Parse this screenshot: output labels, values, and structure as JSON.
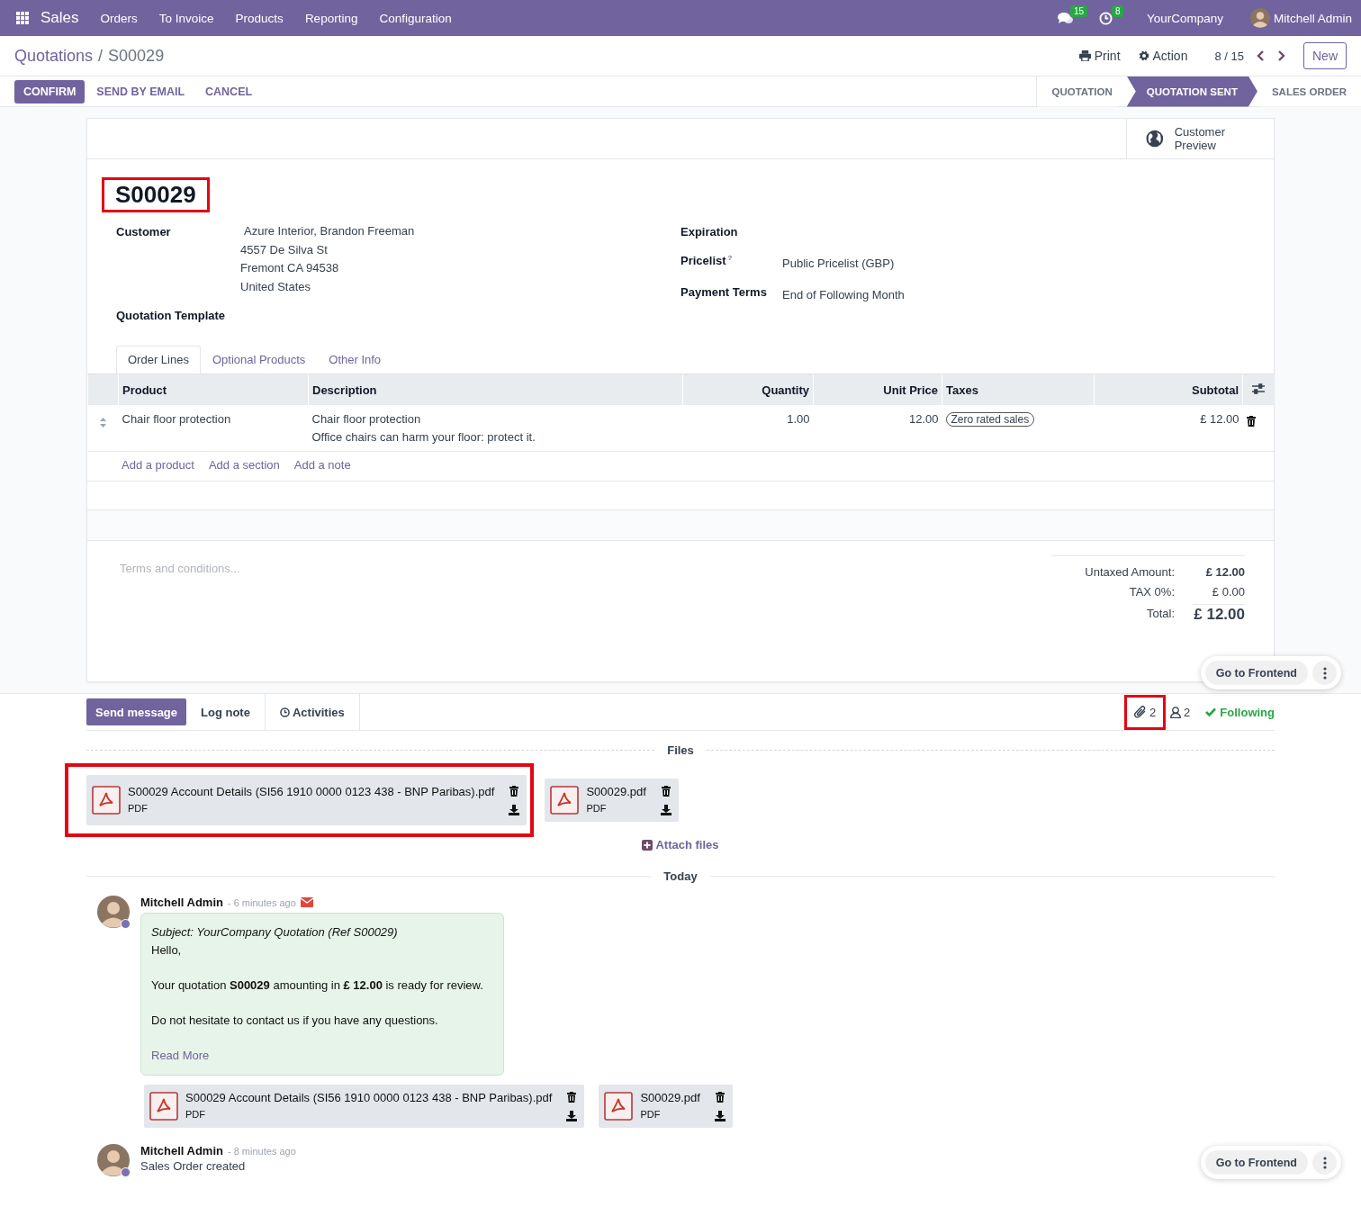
{
  "navbar": {
    "app": "Sales",
    "menus": [
      "Orders",
      "To Invoice",
      "Products",
      "Reporting",
      "Configuration"
    ],
    "messages_count": "15",
    "activities_count": "8",
    "company": "YourCompany",
    "user": "Mitchell Admin"
  },
  "breadcrumb": {
    "parent": "Quotations",
    "separator": "/",
    "current": "S00029"
  },
  "toolbar": {
    "print": "Print",
    "action": "Action",
    "pager": "8 / 15",
    "new": "New"
  },
  "buttons": [
    {
      "label": "CONFIRM",
      "primary": true
    },
    {
      "label": "SEND BY EMAIL",
      "primary": false
    },
    {
      "label": "CANCEL",
      "primary": false
    }
  ],
  "statusbar": [
    {
      "label": "QUOTATION",
      "selected": false
    },
    {
      "label": "QUOTATION SENT",
      "selected": true
    },
    {
      "label": "SALES ORDER",
      "selected": false
    }
  ],
  "form": {
    "smart_button": "Customer Preview",
    "title": {
      "text": "S00029",
      "highlighted": true
    },
    "left_fields": [
      {
        "label": "Customer",
        "lines": [
          "Azure Interior, Brandon Freeman",
          "4557 De Silva St",
          "Fremont CA 94538",
          "United States"
        ]
      },
      {
        "label": "Quotation Template"
      }
    ],
    "right_fields": [
      {
        "label": "Expiration"
      },
      {
        "label": "Pricelist",
        "help": "?",
        "value": "Public Pricelist (GBP)"
      },
      {
        "label": "Payment Terms",
        "value": "End of Following Month"
      }
    ],
    "tabs": [
      {
        "label": "Order Lines",
        "selected": true
      },
      {
        "label": "Optional Products",
        "selected": false
      },
      {
        "label": "Other Info",
        "selected": false
      }
    ],
    "columns": [
      "Product",
      "Description",
      "Quantity",
      "Unit Price",
      "Taxes",
      "Subtotal"
    ],
    "rows": [
      {
        "product": "Chair floor protection",
        "description": [
          "Chair floor protection",
          "Office chairs can harm your floor: protect it."
        ],
        "quantity": "1.00",
        "unit_price": "12.00",
        "taxes": [
          "Zero rated sales"
        ],
        "subtotal": "£ 12.00"
      }
    ],
    "add_links": [
      "Add a product",
      "Add a section",
      "Add a note"
    ],
    "terms_placeholder": "Terms and conditions...",
    "totals": [
      {
        "label": "Untaxed Amount:",
        "value": "£ 12.00",
        "kind": "subtotal"
      },
      {
        "label": "TAX 0%:",
        "value": "£ 0.00",
        "kind": "tax"
      },
      {
        "label": "Total:",
        "value": "£ 12.00",
        "kind": "total"
      }
    ],
    "frontend_button": "Go to Frontend"
  },
  "chatter": {
    "actions": [
      {
        "label": "Send message",
        "primary": true
      },
      {
        "label": "Log note",
        "primary": false
      },
      {
        "label": "Activities",
        "primary": false
      }
    ],
    "attachments_count": {
      "text": "2",
      "highlighted": true
    },
    "followers_count": "2",
    "following": "Following",
    "files_label": "Files",
    "files": [
      {
        "name": "S00029 Account Details (SI56 1910 0000 0123 438 - BNP Paribas).pdf",
        "type": "PDF",
        "highlighted": true
      },
      {
        "name": "S00029.pdf",
        "type": "PDF",
        "highlighted": false
      }
    ],
    "attach": "Attach files",
    "date_label": "Today",
    "messages": [
      {
        "kind": "email",
        "author": "Mitchell Admin",
        "time": "- 6 minutes ago",
        "subject": "Subject: YourCompany Quotation (Ref S00029)",
        "paragraphs": [
          "Hello,",
          "Your quotation **S00029** amounting in **£ 12.00** is ready for review.",
          "Do not hesitate to contact us if you have any questions."
        ],
        "read_more": "Read More",
        "attachments": [
          {
            "name": "S00029 Account Details (SI56 1910 0000 0123 438 - BNP Paribas).pdf",
            "type": "PDF",
            "highlighted": false
          },
          {
            "name": "S00029.pdf",
            "type": "PDF",
            "highlighted": false
          }
        ]
      },
      {
        "kind": "note",
        "author": "Mitchell Admin",
        "time": "- 8 minutes ago",
        "body": "Sales Order created"
      }
    ],
    "frontend_button": "Go to Frontend"
  }
}
